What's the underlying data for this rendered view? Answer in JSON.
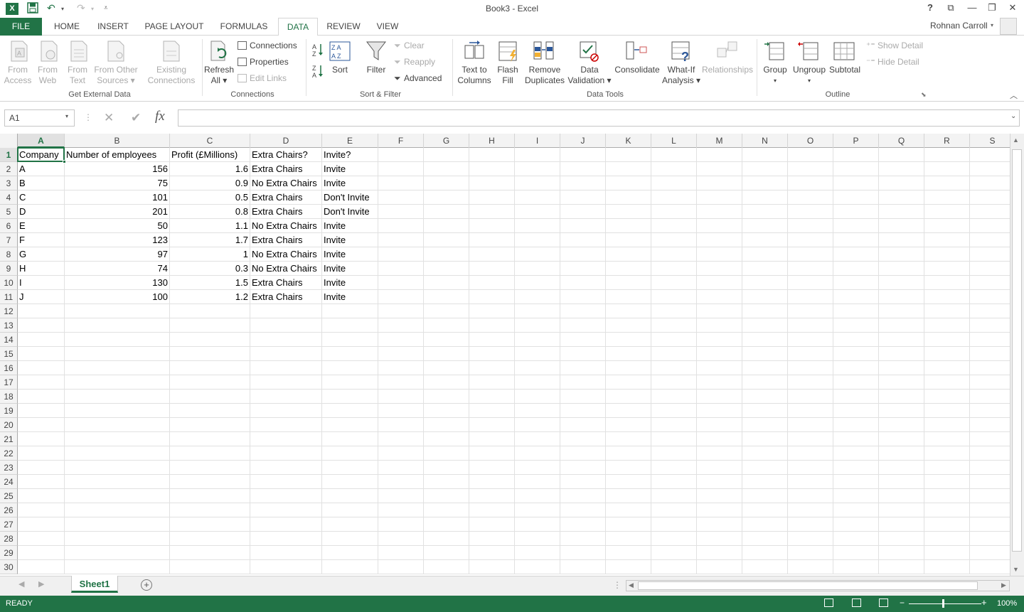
{
  "window": {
    "title": "Book3 - Excel",
    "help": "?",
    "user": "Rohnan Carroll"
  },
  "tabs": [
    "FILE",
    "HOME",
    "INSERT",
    "PAGE LAYOUT",
    "FORMULAS",
    "DATA",
    "REVIEW",
    "VIEW"
  ],
  "ribbon": {
    "get_external": {
      "group": "Get External Data",
      "from_access": [
        "From",
        "Access"
      ],
      "from_web": [
        "From",
        "Web"
      ],
      "from_text": [
        "From",
        "Text"
      ],
      "from_other": [
        "From Other",
        "Sources ▾"
      ],
      "existing": [
        "Existing",
        "Connections"
      ]
    },
    "connections": {
      "group": "Connections",
      "refresh": [
        "Refresh",
        "All ▾"
      ],
      "connections": "Connections",
      "properties": "Properties",
      "edit_links": "Edit Links"
    },
    "sort_filter": {
      "group": "Sort & Filter",
      "sort": "Sort",
      "filter": "Filter",
      "clear": "Clear",
      "reapply": "Reapply",
      "advanced": "Advanced"
    },
    "data_tools": {
      "group": "Data Tools",
      "text_to_columns": [
        "Text to",
        "Columns"
      ],
      "flash_fill": [
        "Flash",
        "Fill"
      ],
      "remove_dup": [
        "Remove",
        "Duplicates"
      ],
      "data_validation": [
        "Data",
        "Validation ▾"
      ],
      "consolidate": "Consolidate",
      "what_if": [
        "What-If",
        "Analysis ▾"
      ],
      "relationships": "Relationships"
    },
    "outline": {
      "group": "Outline",
      "group_btn": "Group",
      "ungroup": "Ungroup",
      "subtotal": "Subtotal",
      "show_detail": "Show Detail",
      "hide_detail": "Hide Detail"
    }
  },
  "formula_bar": {
    "name_box": "A1",
    "fx": "fx",
    "value": ""
  },
  "columns": [
    "A",
    "B",
    "C",
    "D",
    "E",
    "F",
    "G",
    "H",
    "I",
    "J",
    "K",
    "L",
    "M",
    "N",
    "O",
    "P",
    "Q",
    "R",
    "S"
  ],
  "row_numbers": [
    "1",
    "2",
    "3",
    "4",
    "5",
    "6",
    "7",
    "8",
    "9",
    "10",
    "11",
    "12",
    "13",
    "14",
    "15",
    "16",
    "17",
    "18",
    "19",
    "20",
    "21",
    "22",
    "23",
    "24",
    "25",
    "26",
    "27",
    "28",
    "29",
    "30"
  ],
  "sheet": {
    "headers": [
      "Company",
      "Number of employees",
      "Profit (£Millions)",
      "Extra Chairs?",
      "Invite?"
    ],
    "rows": [
      [
        "A",
        "156",
        "1.6",
        "Extra Chairs",
        "Invite"
      ],
      [
        "B",
        "75",
        "0.9",
        "No Extra Chairs",
        "Invite"
      ],
      [
        "C",
        "101",
        "0.5",
        "Extra Chairs",
        "Don't Invite"
      ],
      [
        "D",
        "201",
        "0.8",
        "Extra Chairs",
        "Don't Invite"
      ],
      [
        "E",
        "50",
        "1.1",
        "No Extra Chairs",
        "Invite"
      ],
      [
        "F",
        "123",
        "1.7",
        "Extra Chairs",
        "Invite"
      ],
      [
        "G",
        "97",
        "1",
        "No Extra Chairs",
        "Invite"
      ],
      [
        "H",
        "74",
        "0.3",
        "No Extra Chairs",
        "Invite"
      ],
      [
        "I",
        "130",
        "1.5",
        "Extra Chairs",
        "Invite"
      ],
      [
        "J",
        "100",
        "1.2",
        "Extra Chairs",
        "Invite"
      ]
    ]
  },
  "sheet_tabs": {
    "active": "Sheet1"
  },
  "status": {
    "text": "READY",
    "zoom": "100%"
  },
  "colors": {
    "accent": "#217346"
  }
}
